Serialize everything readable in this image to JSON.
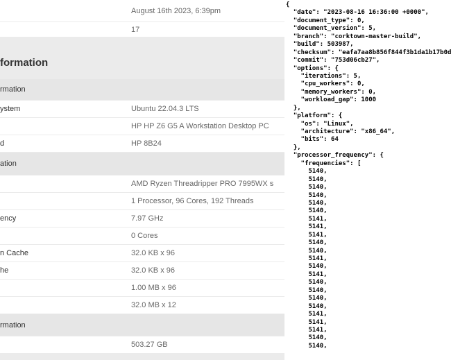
{
  "info": {
    "top_rows": [
      {
        "label": "",
        "value": "August 16th 2023, 6:39pm"
      },
      {
        "label": "",
        "value": "17"
      }
    ],
    "section_title": "formation",
    "groups": [
      {
        "header": "rmation",
        "rows": [
          {
            "label": "ystem",
            "value": "Ubuntu 22.04.3 LTS"
          },
          {
            "label": "",
            "value": "HP HP Z6 G5 A Workstation Desktop PC"
          },
          {
            "label": "d",
            "value": "HP 8B24"
          }
        ]
      },
      {
        "header": "ation",
        "rows": [
          {
            "label": "",
            "value": "AMD Ryzen Threadripper PRO 7995WX s"
          },
          {
            "label": "",
            "value": "1 Processor, 96 Cores, 192 Threads"
          },
          {
            "label": "ency",
            "value": "7.97 GHz"
          },
          {
            "label": "",
            "value": "0 Cores"
          },
          {
            "label": "n Cache",
            "value": "32.0 KB x 96"
          },
          {
            "label": "he",
            "value": "32.0 KB x 96"
          },
          {
            "label": "",
            "value": "1.00 MB x 96"
          },
          {
            "label": "",
            "value": "32.0 MB x 12"
          }
        ]
      },
      {
        "header": "rmation",
        "rows": [
          {
            "label": "",
            "value": "503.27 GB"
          }
        ]
      }
    ]
  },
  "json_lines": [
    "{",
    "  \"date\": \"2023-08-16 16:36:00 +0000\",",
    "  \"document_type\": 0,",
    "  \"document_version\": 5,",
    "  \"branch\": \"corktown-master-build\",",
    "  \"build\": 503987,",
    "  \"checksum\": \"eafa7aa8b856f844f3b1da1b17b0d9",
    "  \"commit\": \"753d06cb27\",",
    "  \"options\": {",
    "    \"iterations\": 5,",
    "    \"cpu_workers\": 0,",
    "    \"memory_workers\": 0,",
    "    \"workload_gap\": 1000",
    "  },",
    "  \"platform\": {",
    "    \"os\": \"Linux\",",
    "    \"architecture\": \"x86_64\",",
    "    \"bits\": 64",
    "  },",
    "  \"processor_frequency\": {",
    "    \"frequencies\": [",
    "      5140,",
    "      5140,",
    "      5140,",
    "      5140,",
    "      5140,",
    "      5140,",
    "      5141,",
    "      5141,",
    "      5141,",
    "      5140,",
    "      5140,",
    "      5141,",
    "      5140,",
    "      5141,",
    "      5140,",
    "      5140,",
    "      5140,",
    "      5140,",
    "      5141,",
    "      5141,",
    "      5141,",
    "      5140,",
    "      5140,"
  ]
}
